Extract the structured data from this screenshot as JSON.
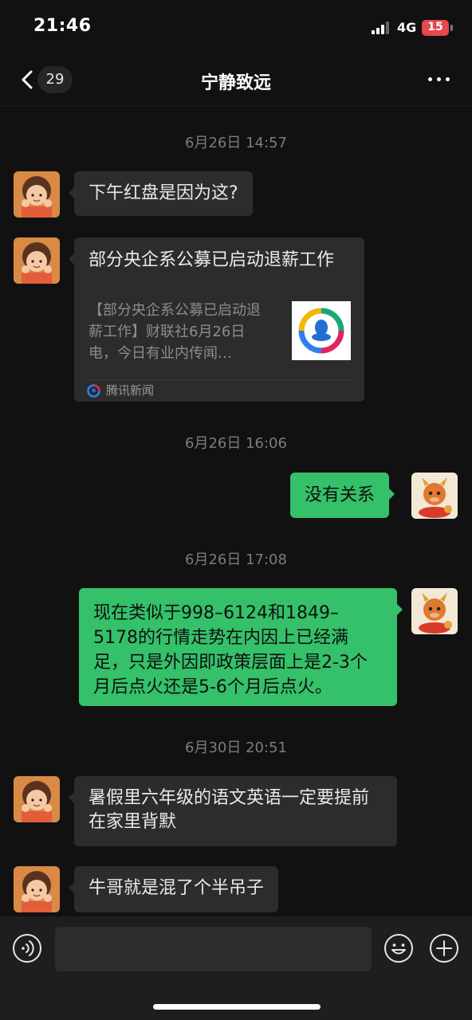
{
  "status_bar": {
    "time": "21:46",
    "network": "4G",
    "battery": "15"
  },
  "nav": {
    "unread_count": "29",
    "title": "宁静致远"
  },
  "messages": {
    "ts1": "6月26日 14:57",
    "m1": "下午红盘是因为这?",
    "card": {
      "title": "部分央企系公募已启动退薪工作",
      "desc": "【部分央企系公募已启动退薪工作】财联社6月26日电，今日有业内传闻…",
      "source": "腾讯新闻"
    },
    "ts2": "6月26日 16:06",
    "m2": "没有关系",
    "ts3": "6月26日 17:08",
    "m3": "现在类似于998–6124和1849–5178的行情走势在内因上已经满足，只是外因即政策层面上是2-3个月后点火还是5-6个月后点火。",
    "ts4": "6月30日 20:51",
    "m4": "暑假里六年级的语文英语一定要提前在家里背默",
    "m5": "牛哥就是混了个半吊子"
  },
  "colors": {
    "background": "#111111",
    "incoming_bubble": "#2c2c2c",
    "outgoing_bubble": "#35c06a",
    "battery": "#e5484d"
  }
}
